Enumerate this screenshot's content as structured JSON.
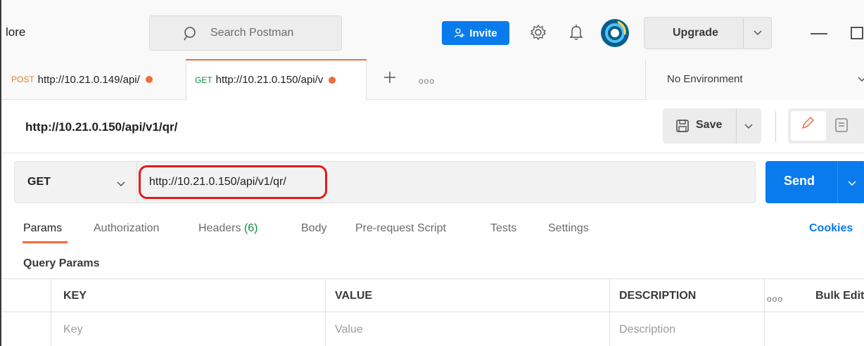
{
  "header": {
    "explore_fragment": "lore",
    "search_placeholder": "Search Postman",
    "invite_label": "Invite",
    "upgrade_label": "Upgrade",
    "icons": [
      "search-icon",
      "add-person-icon",
      "settings-gear-icon",
      "notification-bell-icon",
      "chevron-down-icon"
    ],
    "accent_color": "#097bed"
  },
  "tabs": [
    {
      "method": "POST",
      "url": "http://10.21.0.149/api/",
      "unsaved": true,
      "active": false
    },
    {
      "method": "GET",
      "url": "http://10.21.0.150/api/v",
      "unsaved": true,
      "active": true
    }
  ],
  "tab_more": "ooo",
  "environment": {
    "selected": "No Environment"
  },
  "request": {
    "name": "http://10.21.0.150/api/v1/qr/",
    "save_label": "Save",
    "method": "GET",
    "url": "http://10.21.0.150/api/v1/qr/",
    "send_label": "Send"
  },
  "subtabs": [
    {
      "label": "Params",
      "active": true
    },
    {
      "label": "Authorization"
    },
    {
      "label": "Headers",
      "count": "(6)"
    },
    {
      "label": "Body"
    },
    {
      "label": "Pre-request Script"
    },
    {
      "label": "Tests"
    },
    {
      "label": "Settings"
    }
  ],
  "cookies_label": "Cookies",
  "query_params": {
    "title": "Query Params",
    "columns": [
      "KEY",
      "VALUE",
      "DESCRIPTION"
    ],
    "bulk_edit": "Bulk Edit",
    "more": "ooo",
    "placeholders": [
      "Key",
      "Value",
      "Description"
    ]
  },
  "colors": {
    "send": "#097bed",
    "unsaved_dot": "#f26b3a",
    "get_method": "#0d8a3f",
    "post_method": "#d9822b",
    "highlight_box": "#e31b1b"
  }
}
